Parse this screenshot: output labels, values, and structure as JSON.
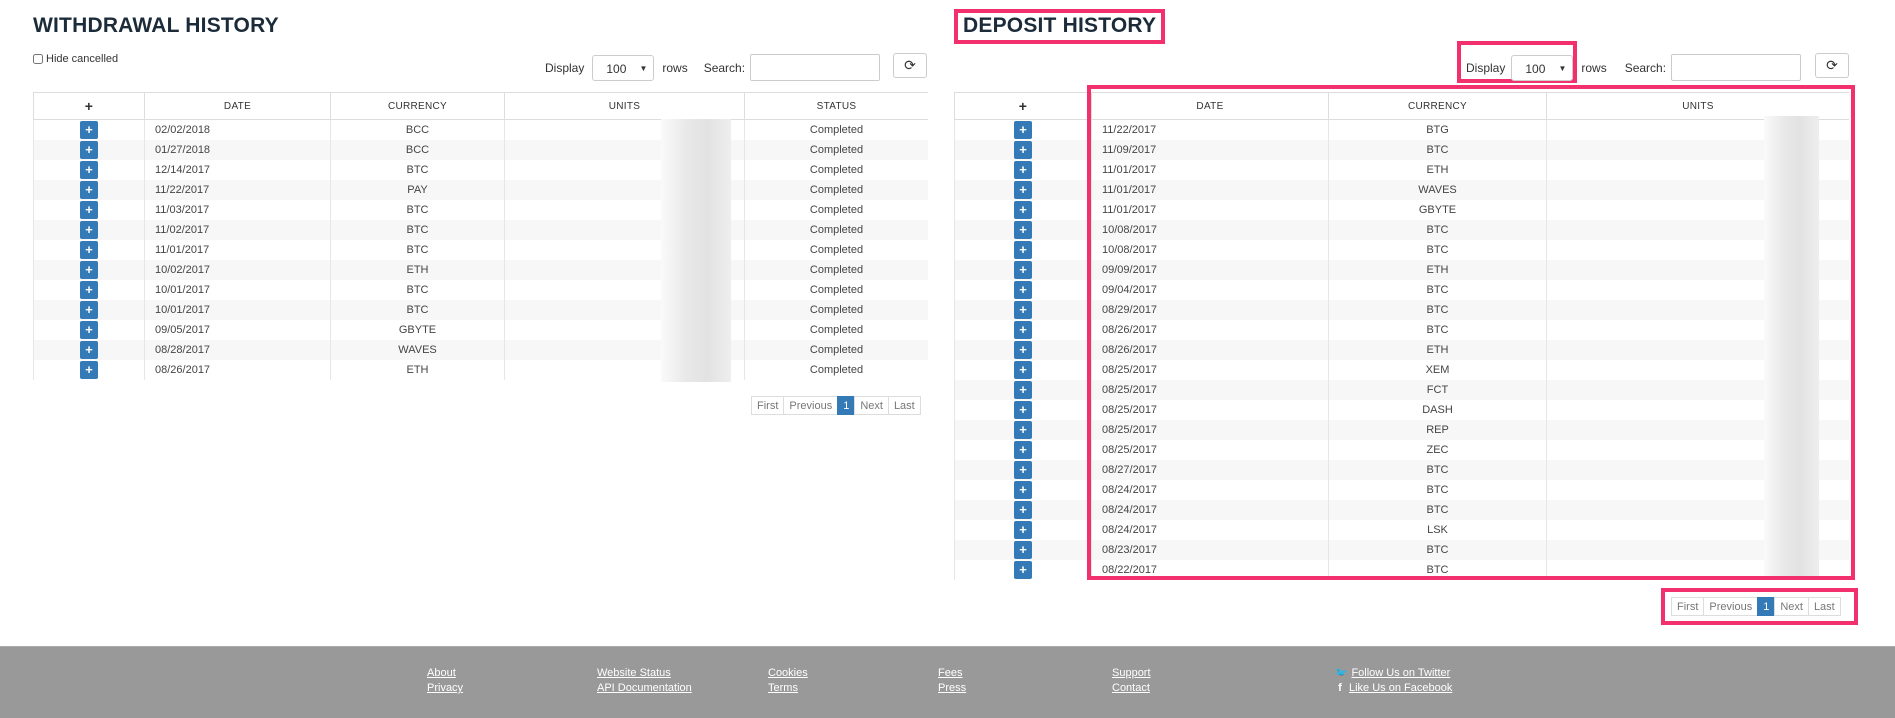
{
  "withdrawal": {
    "title": "WITHDRAWAL HISTORY",
    "hide_cancelled_label": "Hide cancelled",
    "display_label": "Display",
    "display_value": "100",
    "rows_label": "rows",
    "search_label": "Search:",
    "columns": [
      "+",
      "DATE",
      "CURRENCY",
      "UNITS",
      "STATUS"
    ],
    "rows": [
      {
        "date": "02/02/2018",
        "currency": "BCC",
        "status": "Completed"
      },
      {
        "date": "01/27/2018",
        "currency": "BCC",
        "status": "Completed"
      },
      {
        "date": "12/14/2017",
        "currency": "BTC",
        "status": "Completed"
      },
      {
        "date": "11/22/2017",
        "currency": "PAY",
        "status": "Completed"
      },
      {
        "date": "11/03/2017",
        "currency": "BTC",
        "status": "Completed"
      },
      {
        "date": "11/02/2017",
        "currency": "BTC",
        "status": "Completed"
      },
      {
        "date": "11/01/2017",
        "currency": "BTC",
        "status": "Completed"
      },
      {
        "date": "10/02/2017",
        "currency": "ETH",
        "status": "Completed"
      },
      {
        "date": "10/01/2017",
        "currency": "BTC",
        "status": "Completed"
      },
      {
        "date": "10/01/2017",
        "currency": "BTC",
        "status": "Completed"
      },
      {
        "date": "09/05/2017",
        "currency": "GBYTE",
        "status": "Completed"
      },
      {
        "date": "08/28/2017",
        "currency": "WAVES",
        "status": "Completed"
      },
      {
        "date": "08/26/2017",
        "currency": "ETH",
        "status": "Completed"
      }
    ],
    "pager": [
      "First",
      "Previous",
      "1",
      "Next",
      "Last"
    ]
  },
  "deposit": {
    "title": "DEPOSIT HISTORY",
    "display_label": "Display",
    "display_value": "100",
    "rows_label": "rows",
    "search_label": "Search:",
    "columns": [
      "+",
      "DATE",
      "CURRENCY",
      "UNITS"
    ],
    "rows": [
      {
        "date": "11/22/2017",
        "currency": "BTG"
      },
      {
        "date": "11/09/2017",
        "currency": "BTC"
      },
      {
        "date": "11/01/2017",
        "currency": "ETH"
      },
      {
        "date": "11/01/2017",
        "currency": "WAVES"
      },
      {
        "date": "11/01/2017",
        "currency": "GBYTE"
      },
      {
        "date": "10/08/2017",
        "currency": "BTC"
      },
      {
        "date": "10/08/2017",
        "currency": "BTC"
      },
      {
        "date": "09/09/2017",
        "currency": "ETH"
      },
      {
        "date": "09/04/2017",
        "currency": "BTC"
      },
      {
        "date": "08/29/2017",
        "currency": "BTC"
      },
      {
        "date": "08/26/2017",
        "currency": "BTC"
      },
      {
        "date": "08/26/2017",
        "currency": "ETH"
      },
      {
        "date": "08/25/2017",
        "currency": "XEM"
      },
      {
        "date": "08/25/2017",
        "currency": "FCT"
      },
      {
        "date": "08/25/2017",
        "currency": "DASH"
      },
      {
        "date": "08/25/2017",
        "currency": "REP"
      },
      {
        "date": "08/25/2017",
        "currency": "ZEC"
      },
      {
        "date": "08/27/2017",
        "currency": "BTC"
      },
      {
        "date": "08/24/2017",
        "currency": "BTC"
      },
      {
        "date": "08/24/2017",
        "currency": "BTC"
      },
      {
        "date": "08/24/2017",
        "currency": "LSK"
      },
      {
        "date": "08/23/2017",
        "currency": "BTC"
      },
      {
        "date": "08/22/2017",
        "currency": "BTC"
      }
    ],
    "pager": [
      "First",
      "Previous",
      "1",
      "Next",
      "Last"
    ]
  },
  "footer": {
    "col1": [
      "About",
      "Privacy"
    ],
    "col2": [
      "Website Status",
      "API Documentation"
    ],
    "col3": [
      "Cookies",
      "Terms"
    ],
    "col4": [
      "Fees",
      "Press"
    ],
    "col5": [
      "Support",
      "Contact"
    ],
    "col6": [
      "Follow Us on Twitter",
      "Like Us on Facebook"
    ]
  },
  "colors": {
    "highlight": "#f2306d",
    "button": "#337ab7",
    "footer": "#999999"
  }
}
